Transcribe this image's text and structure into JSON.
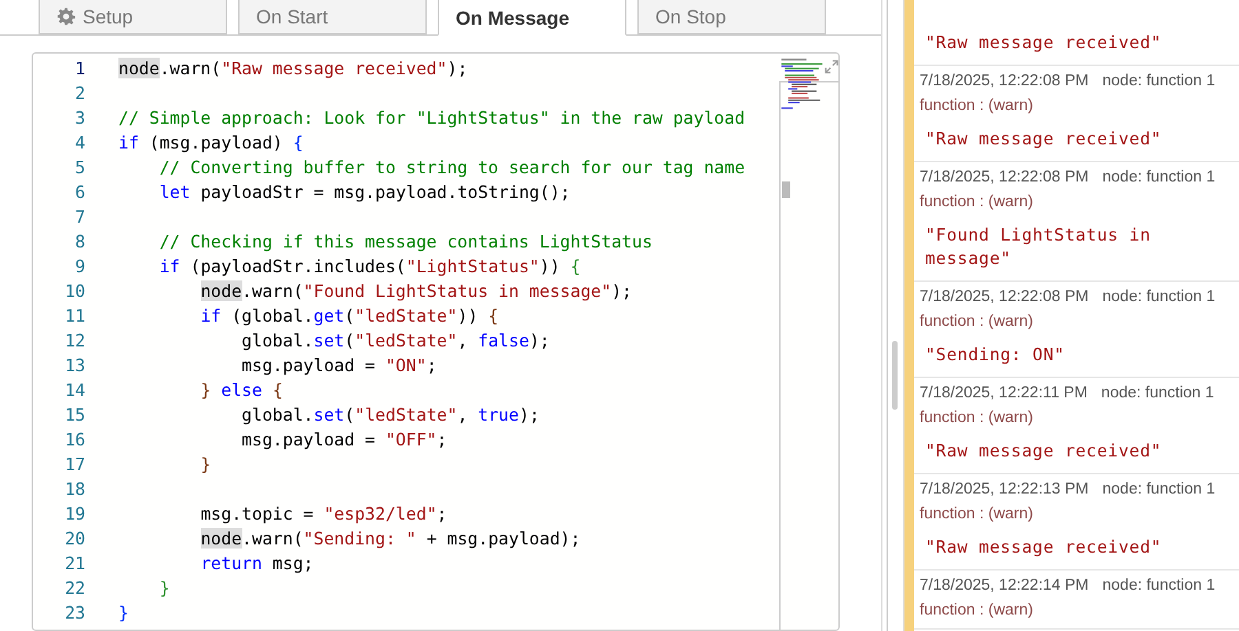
{
  "tabs": [
    {
      "label": "Setup",
      "selected": false
    },
    {
      "label": "On Start",
      "selected": false
    },
    {
      "label": "On Message",
      "selected": true
    },
    {
      "label": "On Stop",
      "selected": false
    }
  ],
  "editor": {
    "lines": [
      {
        "number": "1",
        "active": true,
        "tokens": [
          {
            "kind": "mark",
            "text": "node"
          },
          {
            "kind": "plain",
            "text": ".warn("
          },
          {
            "kind": "str",
            "text": "\"Raw message received\""
          },
          {
            "kind": "plain",
            "text": ");"
          }
        ]
      },
      {
        "number": "2",
        "active": false
      },
      {
        "number": "3",
        "active": false,
        "tokens": [
          {
            "kind": "comment",
            "text": "// Simple approach: Look for \"LightStatus\" in the raw payload"
          }
        ]
      },
      {
        "number": "4",
        "active": false,
        "tokens": [
          {
            "kind": "kw",
            "text": "if"
          },
          {
            "kind": "plain",
            "text": " (msg.payload) "
          },
          {
            "kind": "b1",
            "text": "{"
          }
        ]
      },
      {
        "number": "5",
        "active": false,
        "tokens": [
          {
            "kind": "comment",
            "text": "    // Converting buffer to string to search for our tag name"
          }
        ]
      },
      {
        "number": "6",
        "active": false,
        "tokens": [
          {
            "kind": "kw",
            "text": "    let"
          },
          {
            "kind": "plain",
            "text": " payloadStr = msg.payload.toString();"
          }
        ]
      },
      {
        "number": "7",
        "active": false
      },
      {
        "number": "8",
        "active": false,
        "tokens": [
          {
            "kind": "comment",
            "text": "    // Checking if this message contains LightStatus"
          }
        ]
      },
      {
        "number": "9",
        "active": false,
        "tokens": [
          {
            "kind": "kw",
            "text": "    if"
          },
          {
            "kind": "plain",
            "text": " (payloadStr.includes("
          },
          {
            "kind": "str",
            "text": "\"LightStatus\""
          },
          {
            "kind": "plain",
            "text": ")) "
          },
          {
            "kind": "b2",
            "text": "{"
          }
        ]
      },
      {
        "number": "10",
        "active": false,
        "tokens": [
          {
            "kind": "mark",
            "text": "        node"
          },
          {
            "kind": "plain",
            "text": ".warn("
          },
          {
            "kind": "str",
            "text": "\"Found LightStatus in message\""
          },
          {
            "kind": "plain",
            "text": ");"
          }
        ]
      },
      {
        "number": "11",
        "active": false,
        "tokens": [
          {
            "kind": "kw",
            "text": "        if"
          },
          {
            "kind": "plain",
            "text": " (global."
          },
          {
            "kind": "kw",
            "text": "get"
          },
          {
            "kind": "plain",
            "text": "("
          },
          {
            "kind": "str",
            "text": "\"ledState\""
          },
          {
            "kind": "plain",
            "text": ")) "
          },
          {
            "kind": "b3",
            "text": "{"
          }
        ]
      },
      {
        "number": "12",
        "active": false,
        "tokens": [
          {
            "kind": "plain",
            "text": "            global."
          },
          {
            "kind": "kw",
            "text": "set"
          },
          {
            "kind": "plain",
            "text": "("
          },
          {
            "kind": "str",
            "text": "\"ledState\""
          },
          {
            "kind": "plain",
            "text": ", "
          },
          {
            "kind": "kw",
            "text": "false"
          },
          {
            "kind": "plain",
            "text": ");"
          }
        ]
      },
      {
        "number": "13",
        "active": false,
        "tokens": [
          {
            "kind": "plain",
            "text": "            msg.payload = "
          },
          {
            "kind": "str",
            "text": "\"ON\""
          },
          {
            "kind": "plain",
            "text": ";"
          }
        ]
      },
      {
        "number": "14",
        "active": false,
        "tokens": [
          {
            "kind": "b3",
            "text": "        }"
          },
          {
            "kind": "kw",
            "text": " else"
          },
          {
            "kind": "b3",
            "text": " {"
          }
        ]
      },
      {
        "number": "15",
        "active": false,
        "tokens": [
          {
            "kind": "plain",
            "text": "            global."
          },
          {
            "kind": "kw",
            "text": "set"
          },
          {
            "kind": "plain",
            "text": "("
          },
          {
            "kind": "str",
            "text": "\"ledState\""
          },
          {
            "kind": "plain",
            "text": ", "
          },
          {
            "kind": "kw",
            "text": "true"
          },
          {
            "kind": "plain",
            "text": ");"
          }
        ]
      },
      {
        "number": "16",
        "active": false,
        "tokens": [
          {
            "kind": "plain",
            "text": "            msg.payload = "
          },
          {
            "kind": "str",
            "text": "\"OFF\""
          },
          {
            "kind": "plain",
            "text": ";"
          }
        ]
      },
      {
        "number": "17",
        "active": false,
        "tokens": [
          {
            "kind": "b3",
            "text": "        }"
          }
        ]
      },
      {
        "number": "18",
        "active": false
      },
      {
        "number": "19",
        "active": false,
        "tokens": [
          {
            "kind": "plain",
            "text": "        msg.topic = "
          },
          {
            "kind": "str",
            "text": "\"esp32/led\""
          },
          {
            "kind": "plain",
            "text": ";"
          }
        ]
      },
      {
        "number": "20",
        "active": false,
        "tokens": [
          {
            "kind": "mark",
            "text": "        node"
          },
          {
            "kind": "plain",
            "text": ".warn("
          },
          {
            "kind": "str",
            "text": "\"Sending: \""
          },
          {
            "kind": "plain",
            "text": " + msg.payload);"
          }
        ]
      },
      {
        "number": "21",
        "active": false,
        "tokens": [
          {
            "kind": "kw",
            "text": "        return"
          },
          {
            "kind": "plain",
            "text": " msg;"
          }
        ]
      },
      {
        "number": "22",
        "active": false,
        "tokens": [
          {
            "kind": "b2",
            "text": "    }"
          }
        ]
      },
      {
        "number": "23",
        "active": false,
        "tokens": [
          {
            "kind": "b1",
            "text": "}"
          }
        ]
      }
    ]
  },
  "debug": {
    "messages": [
      {
        "message": "\"Raw message received\""
      },
      {
        "time": "7/18/2025, 12:22:08 PM",
        "node": "node: function 1",
        "source": "function : (warn)",
        "message": "\"Raw message received\""
      },
      {
        "time": "7/18/2025, 12:22:08 PM",
        "node": "node: function 1",
        "source": "function : (warn)",
        "message": "\"Found LightStatus in message\""
      },
      {
        "time": "7/18/2025, 12:22:08 PM",
        "node": "node: function 1",
        "source": "function : (warn)",
        "message": "\"Sending: ON\""
      },
      {
        "time": "7/18/2025, 12:22:11 PM",
        "node": "node: function 1",
        "source": "function : (warn)",
        "message": "\"Raw message received\""
      },
      {
        "time": "7/18/2025, 12:22:13 PM",
        "node": "node: function 1",
        "source": "function : (warn)",
        "message": "\"Raw message received\""
      },
      {
        "time": "7/18/2025, 12:22:14 PM",
        "node": "node: function 1",
        "source": "function : (warn)"
      }
    ]
  }
}
